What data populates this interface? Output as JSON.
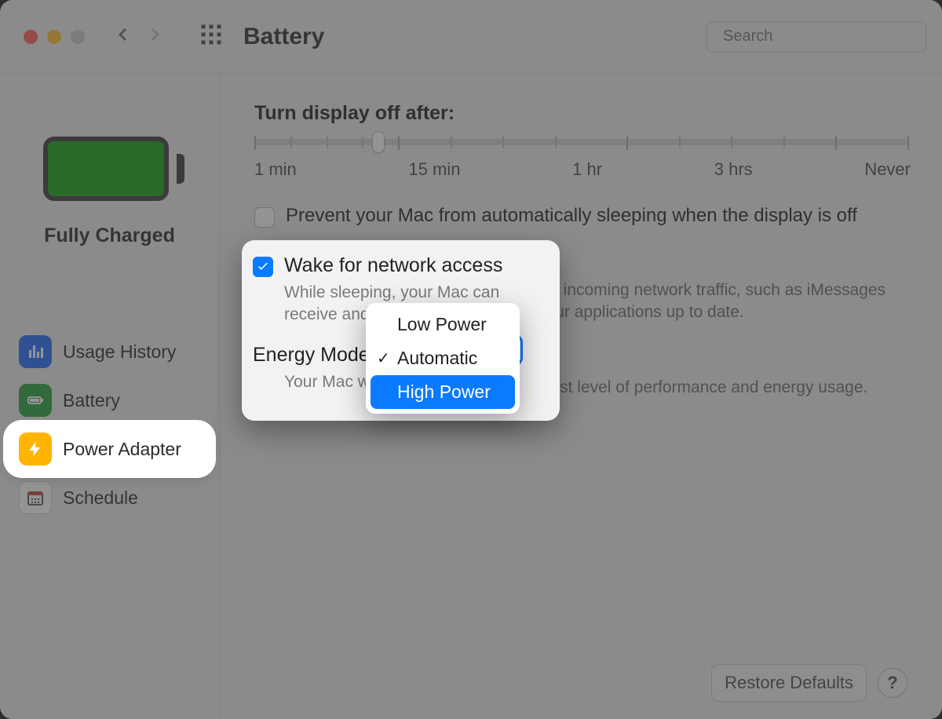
{
  "toolbar": {
    "title": "Battery",
    "back_label": "Back",
    "forward_label": "Forward",
    "search_placeholder": "Search"
  },
  "sidebar": {
    "battery_status": "Fully Charged",
    "items": [
      {
        "id": "usage-history",
        "label": "Usage History"
      },
      {
        "id": "battery",
        "label": "Battery"
      },
      {
        "id": "power-adapter",
        "label": "Power Adapter"
      },
      {
        "id": "schedule",
        "label": "Schedule"
      }
    ],
    "selected_id": "power-adapter"
  },
  "main": {
    "display_off_title": "Turn display off after:",
    "slider_ticks": [
      "1 min",
      "15 min",
      "1 hr",
      "3 hrs",
      "Never"
    ],
    "slider_value_pct": 19,
    "prevent_sleep_label": "Prevent your Mac from automatically sleeping when the display is off",
    "prevent_sleep_checked": false,
    "wake_network_label": "Wake for network access",
    "wake_network_checked": true,
    "wake_network_desc": "While sleeping, your Mac can receive incoming network traffic, such as iMessages and other iCloud updates, to keep your applications up to date.",
    "energy_mode_label": "Energy Mode:",
    "energy_mode_desc": "Your Mac will automatically choose the best level of performance and energy usage.",
    "energy_mode_options": [
      "Low Power",
      "Automatic",
      "High Power"
    ],
    "energy_mode_selected": "Automatic",
    "energy_mode_hovered": "High Power",
    "restore_label": "Restore Defaults",
    "help_label": "?"
  },
  "callout": {
    "wake_sub_visible": "While sleeping, your Mac can receive and other iC",
    "energy_sub_visible": "Your Mac w"
  }
}
